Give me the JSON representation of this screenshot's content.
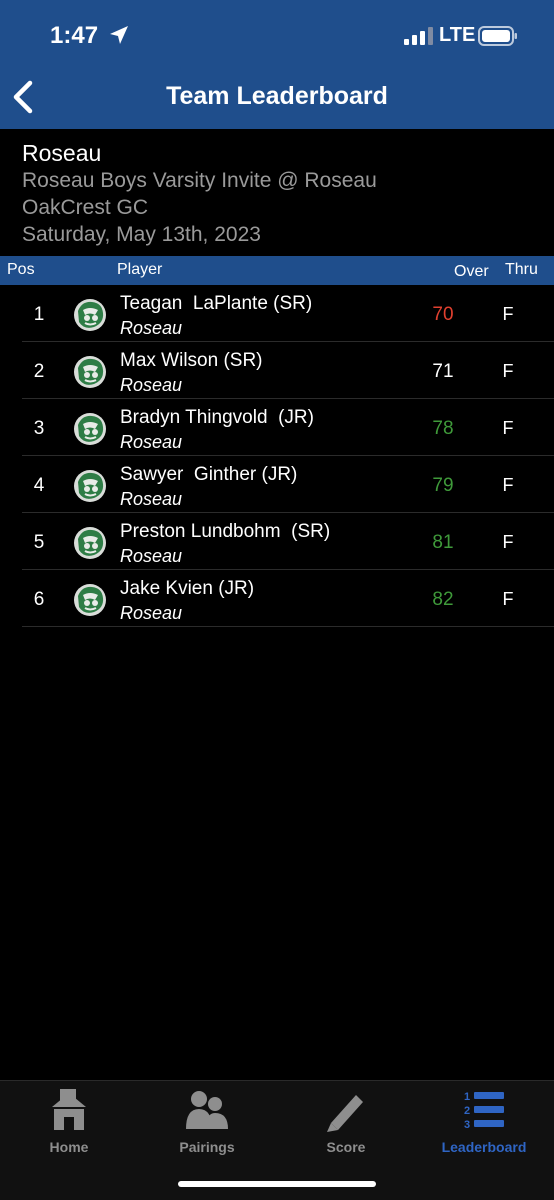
{
  "status": {
    "time": "1:47",
    "network": "LTE"
  },
  "header": {
    "title": "Team Leaderboard"
  },
  "event": {
    "team": "Roseau",
    "name": "Roseau Boys Varsity Invite @ Roseau",
    "course": "OakCrest GC",
    "date": "Saturday, May 13th, 2023"
  },
  "columns": {
    "pos": "Pos",
    "player": "Player",
    "over": "Over",
    "thru": "Thru"
  },
  "players": [
    {
      "pos": "1",
      "name": "Teagan  LaPlante (SR)",
      "team": "Roseau",
      "score": "70",
      "score_color": "#e0402f",
      "thru": "F"
    },
    {
      "pos": "2",
      "name": "Max Wilson (SR)",
      "team": "Roseau",
      "score": "71",
      "score_color": "#ffffff",
      "thru": "F"
    },
    {
      "pos": "3",
      "name": "Bradyn Thingvold  (JR)",
      "team": "Roseau",
      "score": "78",
      "score_color": "#3f9a3a",
      "thru": "F"
    },
    {
      "pos": "4",
      "name": "Sawyer  Ginther (JR)",
      "team": "Roseau",
      "score": "79",
      "score_color": "#3f9a3a",
      "thru": "F"
    },
    {
      "pos": "5",
      "name": "Preston Lundbohm  (SR)",
      "team": "Roseau",
      "score": "81",
      "score_color": "#3f9a3a",
      "thru": "F"
    },
    {
      "pos": "6",
      "name": "Jake Kvien (JR)",
      "team": "Roseau",
      "score": "82",
      "score_color": "#3f9a3a",
      "thru": "F"
    }
  ],
  "tabs": [
    {
      "label": "Home",
      "icon": "home-icon",
      "active": false
    },
    {
      "label": "Pairings",
      "icon": "people-icon",
      "active": false
    },
    {
      "label": "Score",
      "icon": "pencil-icon",
      "active": false
    },
    {
      "label": "Leaderboard",
      "icon": "ranked-list-icon",
      "active": true
    }
  ],
  "colors": {
    "header_bg": "#1f4e8c",
    "active_tab": "#2f65c4",
    "logo_green": "#2e7d46"
  }
}
